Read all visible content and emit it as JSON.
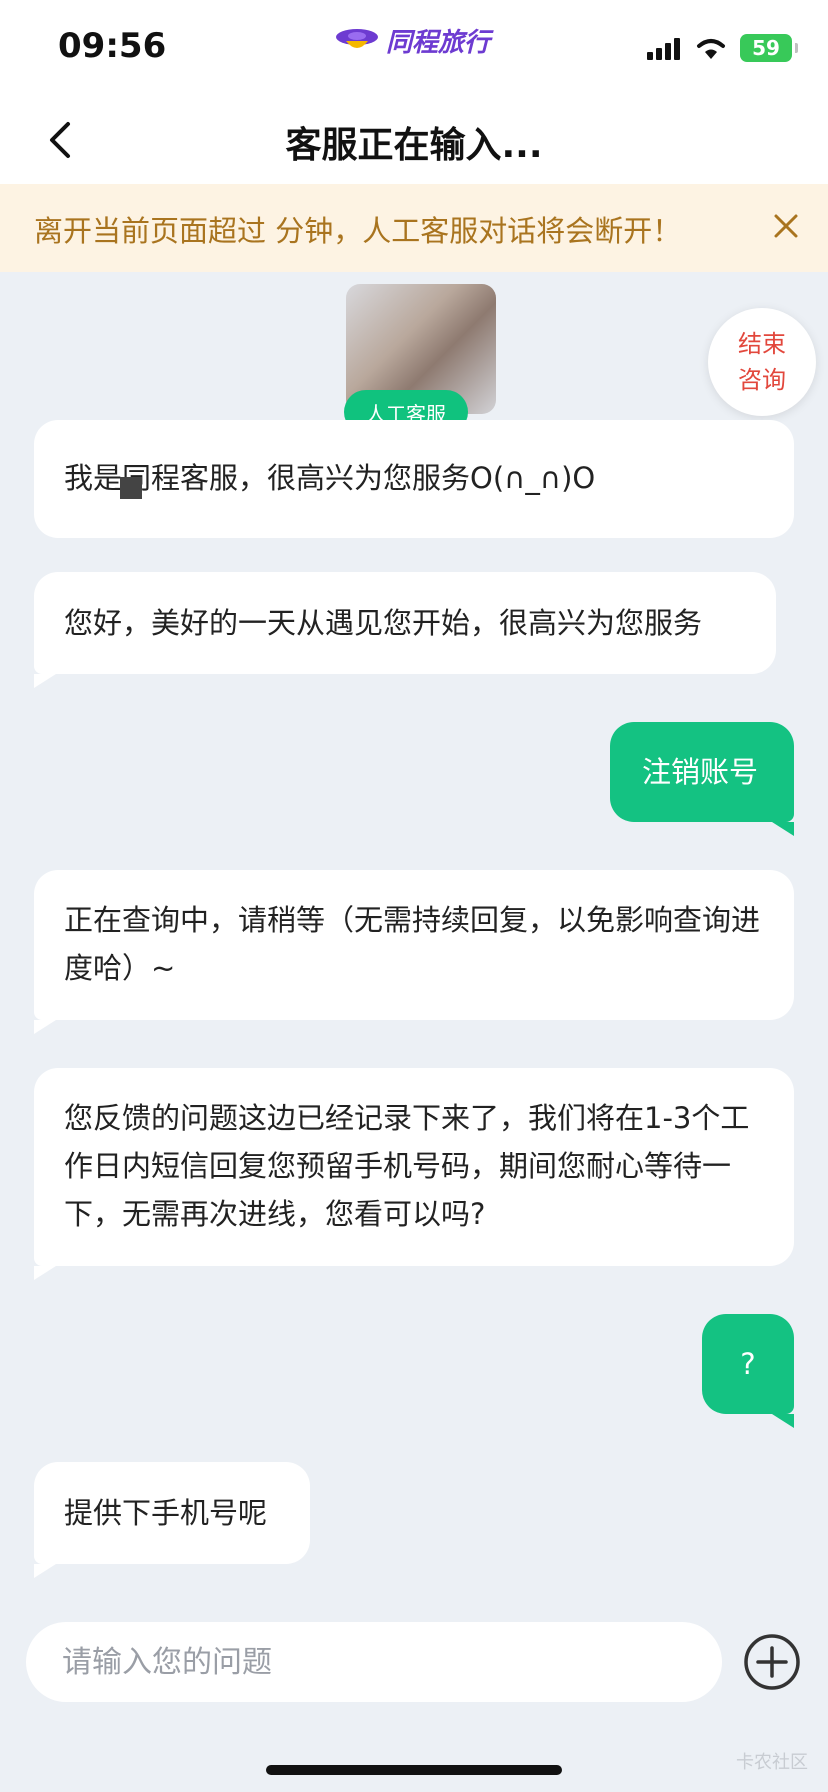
{
  "status_bar": {
    "time": "09:56",
    "battery": "59"
  },
  "app": {
    "logo_text": "同程旅行"
  },
  "nav": {
    "title": "客服正在输入..."
  },
  "notice": {
    "text": "离开当前页面超过  分钟，人工客服对话将会断开！"
  },
  "end_button": {
    "line1": "结束",
    "line2": "咨询"
  },
  "agent_tag": "人工客服",
  "messages": [
    {
      "sender": "agent",
      "text": "我是同程客服，很高兴为您服务O(∩_∩)O"
    },
    {
      "sender": "agent",
      "text": "您好，美好的一天从遇见您开始，很高兴为您服务"
    },
    {
      "sender": "user",
      "text": "注销账号"
    },
    {
      "sender": "agent",
      "text": "正在查询中，请稍等（无需持续回复，以免影响查询进度哈）~"
    },
    {
      "sender": "agent",
      "text": "您反馈的问题这边已经记录下来了，我们将在1-3个工作日内短信回复您预留手机号码，期间您耐心等待一下，无需再次进线，您看可以吗?"
    },
    {
      "sender": "user",
      "text": "?"
    },
    {
      "sender": "agent",
      "text": "提供下手机号呢"
    }
  ],
  "input": {
    "placeholder": "请输入您的问题"
  },
  "watermark": "卡农社区"
}
